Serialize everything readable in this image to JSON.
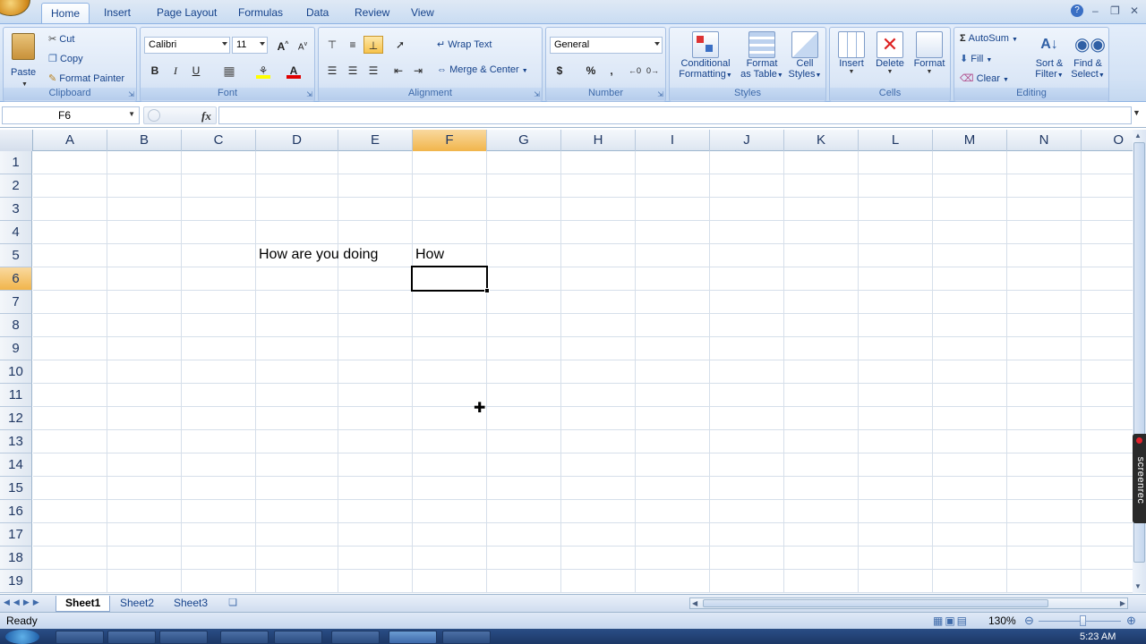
{
  "tabs": [
    "Home",
    "Insert",
    "Page Layout",
    "Formulas",
    "Data",
    "Review",
    "View"
  ],
  "active_tab": "Home",
  "clipboard": {
    "paste": "Paste",
    "cut": "Cut",
    "copy": "Copy",
    "format_painter": "Format Painter",
    "caption": "Clipboard"
  },
  "font": {
    "name": "Calibri",
    "size": "11",
    "bold": "B",
    "italic": "I",
    "underline": "U",
    "caption": "Font"
  },
  "alignment": {
    "wrap_text": "Wrap Text",
    "merge_center": "Merge & Center",
    "caption": "Alignment"
  },
  "number": {
    "format": "General",
    "currency": "$",
    "percent": "%",
    "comma": ",",
    "caption": "Number"
  },
  "styles": {
    "conditional_1": "Conditional",
    "conditional_2": "Formatting",
    "table_1": "Format",
    "table_2": "as Table",
    "cell_1": "Cell",
    "cell_2": "Styles",
    "caption": "Styles"
  },
  "cells": {
    "insert": "Insert",
    "delete": "Delete",
    "format": "Format",
    "caption": "Cells"
  },
  "editing": {
    "autosum": "AutoSum",
    "fill": "Fill",
    "clear": "Clear",
    "sort_1": "Sort &",
    "sort_2": "Filter",
    "find_1": "Find &",
    "find_2": "Select",
    "caption": "Editing"
  },
  "formula_bar": {
    "name_box": "F6",
    "fx": "fx",
    "formula": ""
  },
  "columns": [
    "A",
    "B",
    "C",
    "D",
    "E",
    "F",
    "G",
    "H",
    "I",
    "J",
    "K",
    "L",
    "M",
    "N",
    "O"
  ],
  "rows": [
    "1",
    "2",
    "3",
    "4",
    "5",
    "6",
    "7",
    "8",
    "9",
    "10",
    "11",
    "12",
    "13",
    "14",
    "15",
    "16",
    "17",
    "18",
    "19"
  ],
  "selected_cell": "F6",
  "cell_values": {
    "D5": "How are you doing",
    "F5": "How"
  },
  "sheets": [
    "Sheet1",
    "Sheet2",
    "Sheet3"
  ],
  "active_sheet": "Sheet1",
  "status": {
    "ready": "Ready",
    "zoom": "130%"
  },
  "taskbar": {
    "time": "5:23 AM"
  },
  "watermark": "screenrec",
  "colors": {
    "accent": "#15428b",
    "selection": "#f1b54b",
    "grid": "#d6dfea"
  }
}
